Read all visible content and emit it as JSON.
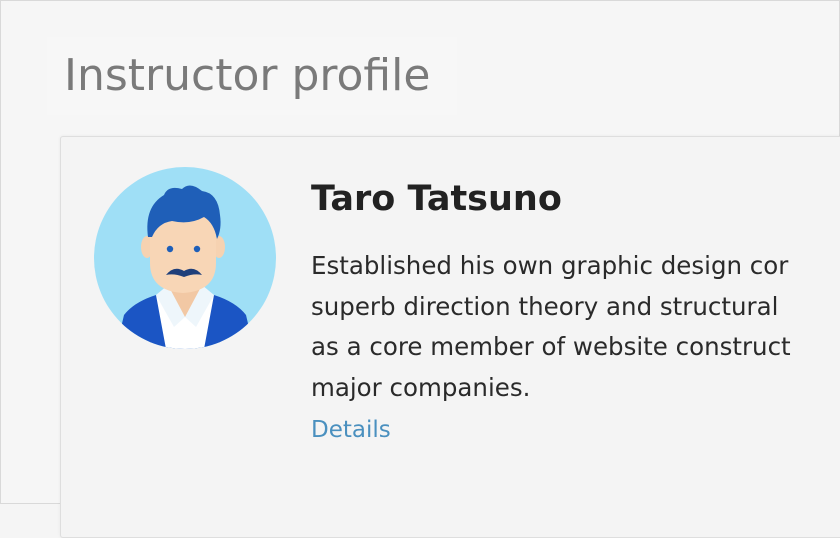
{
  "page": {
    "title": "Instructor profile"
  },
  "instructor": {
    "name": "Taro Tatsuno",
    "bio_lines": [
      "Established his own graphic design cor",
      "superb direction theory and structural",
      "as a core member of website construct",
      "major companies."
    ],
    "details_label": "Details",
    "avatar_icon": "person-with-mustache-icon"
  },
  "colors": {
    "link": "#4a90bf",
    "avatar_background": "#9fdff6",
    "hair": "#1f5fb8",
    "jacket": "#1b55c4"
  }
}
